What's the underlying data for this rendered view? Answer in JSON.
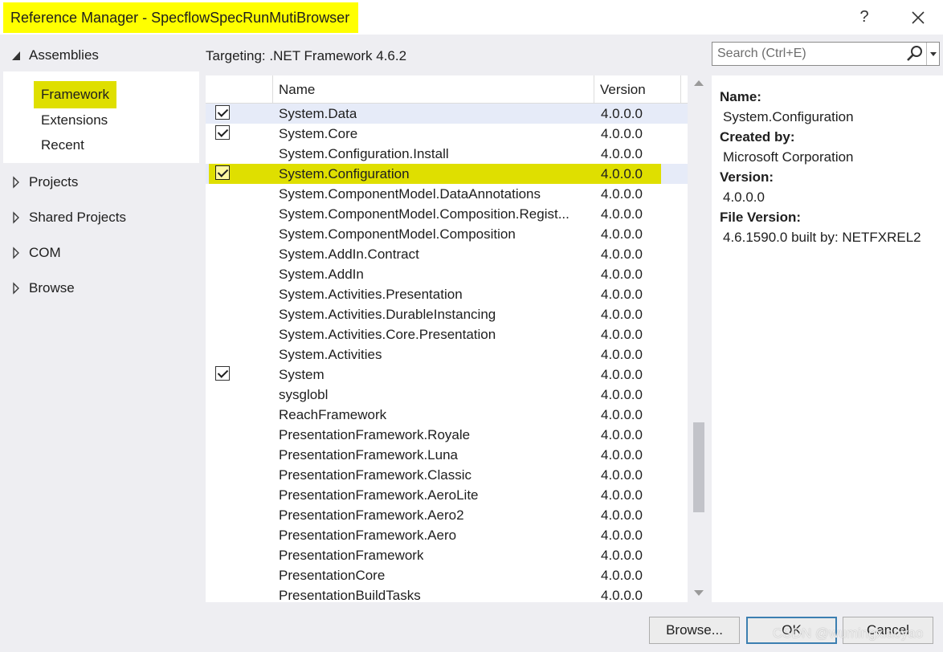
{
  "window": {
    "title": "Reference Manager - SpecflowSpecRunMutiBrowser",
    "help_label": "?",
    "close_icon": "close-icon",
    "highlight_color": "#ffff00"
  },
  "sidebar": {
    "assemblies_label": "Assemblies",
    "assemblies_items": [
      "Framework",
      "Extensions",
      "Recent"
    ],
    "selected": "Framework",
    "groups": [
      "Projects",
      "Shared Projects",
      "COM",
      "Browse"
    ]
  },
  "targeting": "Targeting: .NET Framework 4.6.2",
  "search": {
    "placeholder": "Search (Ctrl+E)"
  },
  "table": {
    "columns": [
      "Name",
      "Version"
    ],
    "rows": [
      {
        "name": "System.Data",
        "version": "4.0.0.0",
        "checked": true
      },
      {
        "name": "System.Core",
        "version": "4.0.0.0",
        "checked": true
      },
      {
        "name": "System.Configuration.Install",
        "version": "4.0.0.0",
        "checked": false
      },
      {
        "name": "System.Configuration",
        "version": "4.0.0.0",
        "checked": true,
        "selected": true
      },
      {
        "name": "System.ComponentModel.DataAnnotations",
        "version": "4.0.0.0",
        "checked": false
      },
      {
        "name": "System.ComponentModel.Composition.Regist...",
        "version": "4.0.0.0",
        "checked": false
      },
      {
        "name": "System.ComponentModel.Composition",
        "version": "4.0.0.0",
        "checked": false
      },
      {
        "name": "System.AddIn.Contract",
        "version": "4.0.0.0",
        "checked": false
      },
      {
        "name": "System.AddIn",
        "version": "4.0.0.0",
        "checked": false
      },
      {
        "name": "System.Activities.Presentation",
        "version": "4.0.0.0",
        "checked": false
      },
      {
        "name": "System.Activities.DurableInstancing",
        "version": "4.0.0.0",
        "checked": false
      },
      {
        "name": "System.Activities.Core.Presentation",
        "version": "4.0.0.0",
        "checked": false
      },
      {
        "name": "System.Activities",
        "version": "4.0.0.0",
        "checked": false
      },
      {
        "name": "System",
        "version": "4.0.0.0",
        "checked": true
      },
      {
        "name": "sysglobl",
        "version": "4.0.0.0",
        "checked": false
      },
      {
        "name": "ReachFramework",
        "version": "4.0.0.0",
        "checked": false
      },
      {
        "name": "PresentationFramework.Royale",
        "version": "4.0.0.0",
        "checked": false
      },
      {
        "name": "PresentationFramework.Luna",
        "version": "4.0.0.0",
        "checked": false
      },
      {
        "name": "PresentationFramework.Classic",
        "version": "4.0.0.0",
        "checked": false
      },
      {
        "name": "PresentationFramework.AeroLite",
        "version": "4.0.0.0",
        "checked": false
      },
      {
        "name": "PresentationFramework.Aero2",
        "version": "4.0.0.0",
        "checked": false
      },
      {
        "name": "PresentationFramework.Aero",
        "version": "4.0.0.0",
        "checked": false
      },
      {
        "name": "PresentationFramework",
        "version": "4.0.0.0",
        "checked": false
      },
      {
        "name": "PresentationCore",
        "version": "4.0.0.0",
        "checked": false
      },
      {
        "name": "PresentationBuildTasks",
        "version": "4.0.0.0",
        "checked": false
      }
    ]
  },
  "details": {
    "name_label": "Name:",
    "name_value": "System.Configuration",
    "created_label": "Created by:",
    "created_value": "Microsoft Corporation",
    "version_label": "Version:",
    "version_value": "4.0.0.0",
    "file_version_label": "File Version:",
    "file_version_value": "4.6.1590.0 built by: NETFXREL2"
  },
  "buttons": {
    "browse": "Browse...",
    "ok": "OK",
    "cancel": "Cancel"
  },
  "watermark": "CSDN @wumingxiaoyao"
}
